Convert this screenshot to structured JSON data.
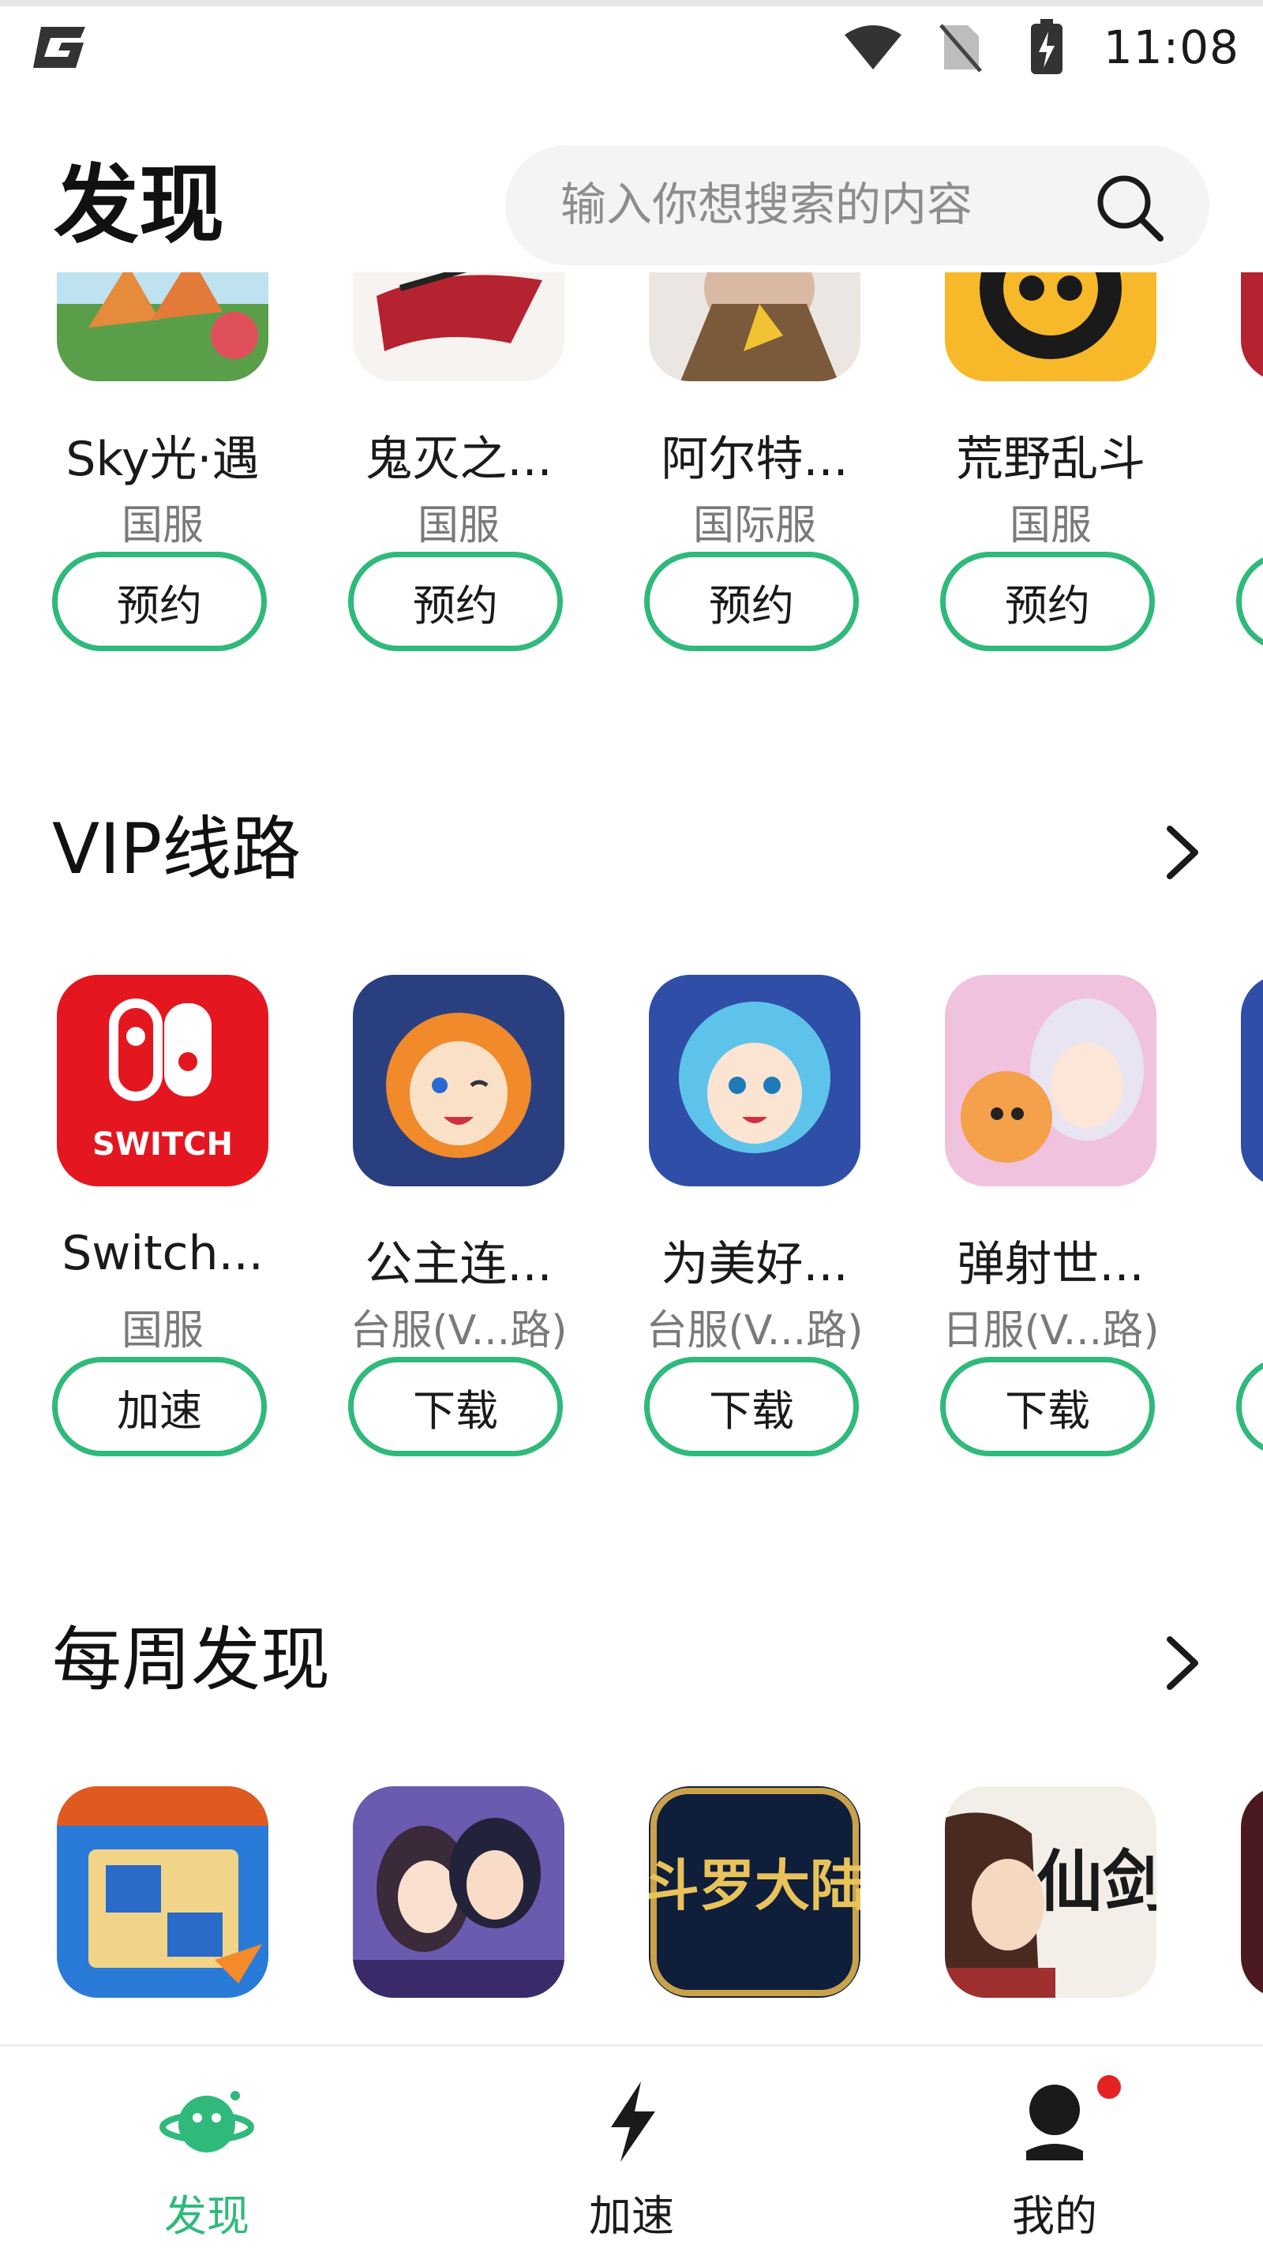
{
  "status_bar": {
    "time": "11:08",
    "icons": [
      "wifi-icon",
      "no-sim-icon",
      "battery-charging-icon"
    ]
  },
  "header": {
    "title": "发现",
    "search_placeholder": "输入你想搜索的内容"
  },
  "reservation_row": {
    "games": [
      {
        "name": "Sky光·遇",
        "server": "国服",
        "button": "预约"
      },
      {
        "name": "鬼灭之...",
        "server": "国服",
        "button": "预约"
      },
      {
        "name": "阿尔特...",
        "server": "国际服",
        "button": "预约"
      },
      {
        "name": "荒野乱斗",
        "server": "国服",
        "button": "预约"
      }
    ]
  },
  "vip_section": {
    "title": "VIP线路",
    "games": [
      {
        "name": "Switch...",
        "server": "国服",
        "button": "加速",
        "icon_text": "SWITCH"
      },
      {
        "name": "公主连...",
        "server": "台服(V...路)",
        "button": "下载"
      },
      {
        "name": "为美好...",
        "server": "台服(V...路)",
        "button": "下载"
      },
      {
        "name": "弹射世...",
        "server": "日服(V...路)",
        "button": "下载"
      }
    ]
  },
  "weekly_section": {
    "title": "每周发现",
    "games": [
      {
        "icon": "game-icon-puzzle"
      },
      {
        "icon": "game-icon-romance"
      },
      {
        "icon": "game-icon-douluo",
        "icon_text": "斗罗大陆"
      },
      {
        "icon": "game-icon-xianjian",
        "icon_text": "仙剑"
      }
    ]
  },
  "bottom_nav": {
    "items": [
      {
        "label": "发现",
        "icon": "planet-icon",
        "active": true
      },
      {
        "label": "加速",
        "icon": "lightning-icon",
        "active": false
      },
      {
        "label": "我的",
        "icon": "user-icon",
        "active": false
      }
    ]
  },
  "colors": {
    "accent": "#2fb97a",
    "badge": "#e52222",
    "text": "#1a1a1a",
    "muted": "#7a7a7a"
  }
}
